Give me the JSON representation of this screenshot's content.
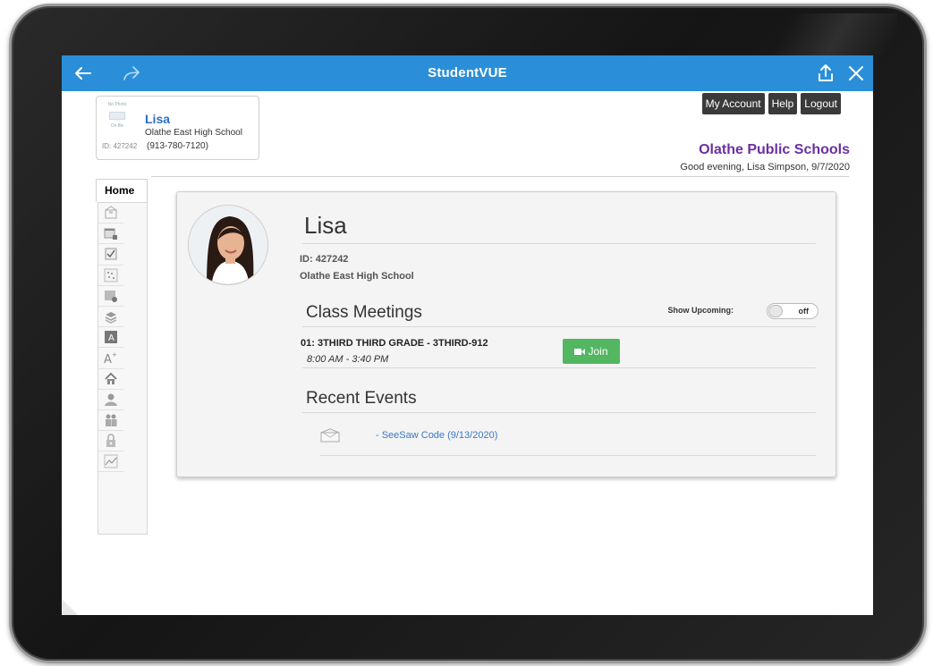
{
  "app": {
    "title": "StudentVUE"
  },
  "topbar": {
    "back_icon": "back-arrow-icon",
    "forward_icon": "forward-arrow-icon",
    "share_icon": "share-icon",
    "close_icon": "close-icon",
    "color": "#2a8fd8"
  },
  "student_card": {
    "photo_placeholder_line1": "No Photo",
    "photo_placeholder_line2": "On file",
    "name": "Lisa",
    "school": "Olathe East High School",
    "id_label": "ID: 427242",
    "phone": "(913-780-7120)"
  },
  "account_buttons": [
    "My Account",
    "Help",
    "Logout"
  ],
  "district": {
    "name": "Olathe Public Schools",
    "color": "#6b2fa3"
  },
  "greeting": "Good evening, Lisa Simpson, 9/7/2020",
  "home_tab": {
    "label": "Home"
  },
  "side_icons": [
    "mail-icon",
    "calendar-lock-icon",
    "attendance-check-icon",
    "grid-dots-icon",
    "report-card-icon",
    "books-icon",
    "gradebook-a-icon",
    "grade-plus-icon",
    "home-icon",
    "student-info-icon",
    "parents-icon",
    "lock-icon",
    "chart-icon"
  ],
  "profile": {
    "name": "Lisa",
    "id": "ID: 427242",
    "school": "Olathe East High School"
  },
  "class_meetings": {
    "title": "Class Meetings",
    "show_upcoming_label": "Show Upcoming:",
    "toggle_state": "off",
    "meetings": [
      {
        "title": "01:  3THIRD THIRD GRADE - 3THIRD-912",
        "time": "8:00 AM - 3:40 PM",
        "join_label": "Join"
      }
    ]
  },
  "recent_events": {
    "title": "Recent Events",
    "events": [
      {
        "text": "- SeeSaw Code (9/13/2020)"
      }
    ]
  }
}
